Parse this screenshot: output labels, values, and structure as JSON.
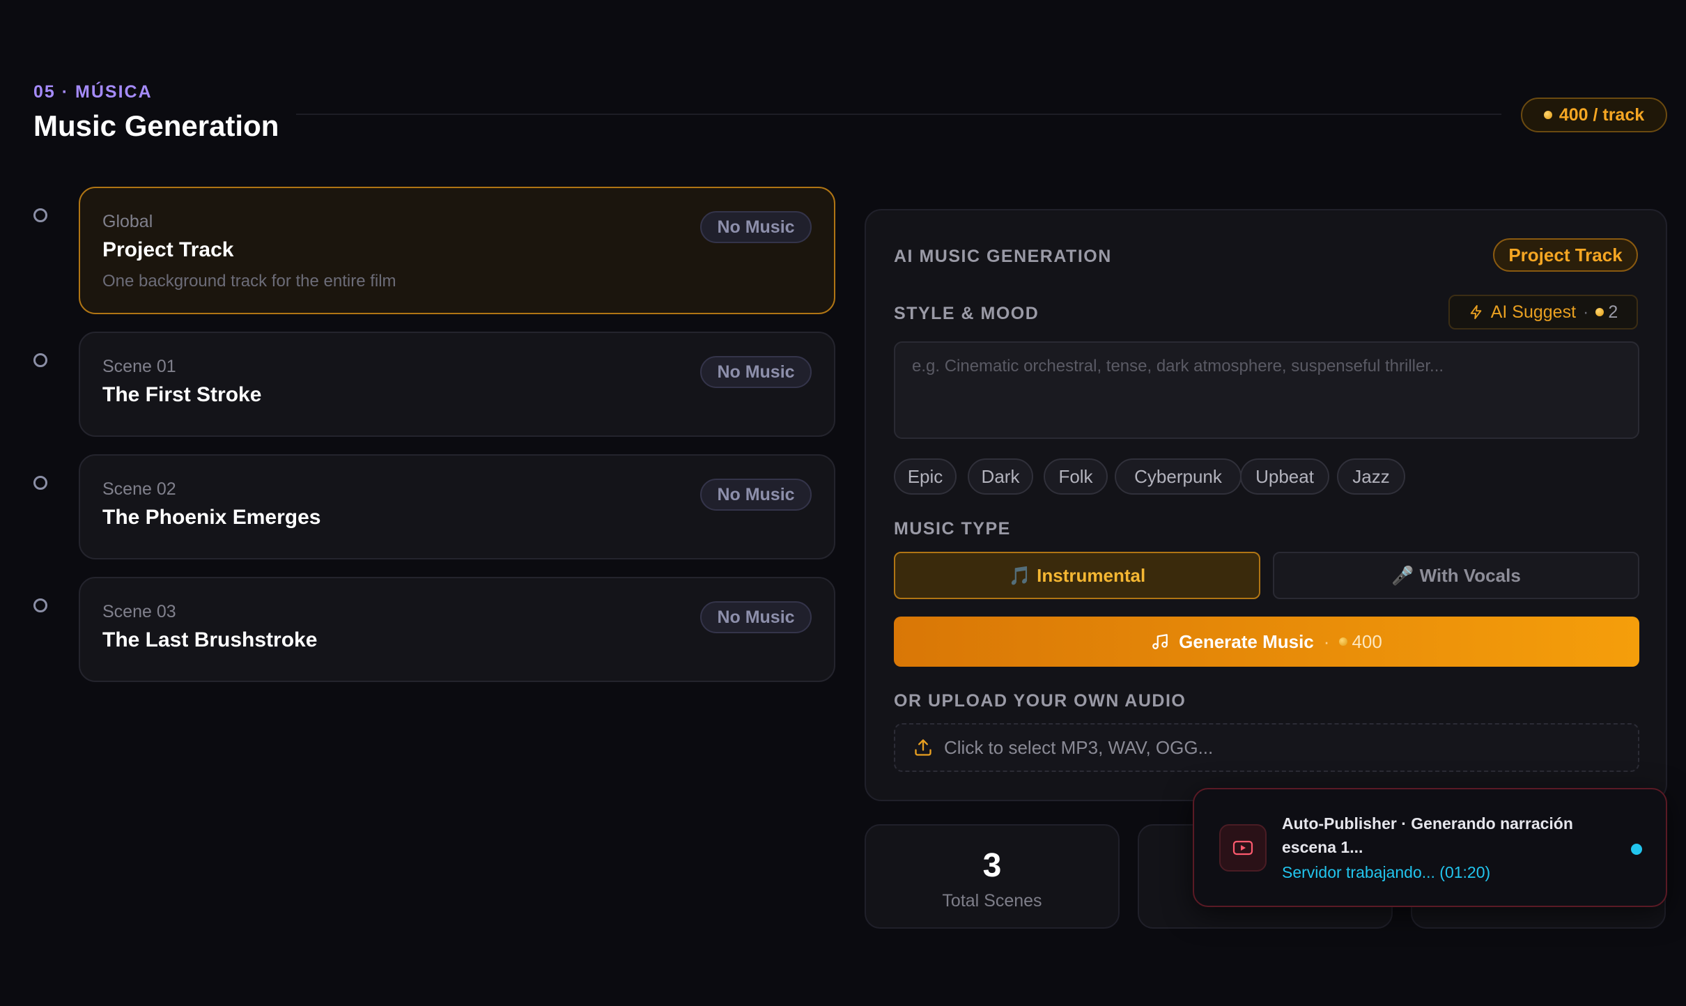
{
  "header": {
    "eyebrow": "05 · MÚSICA",
    "title": "Music Generation",
    "price_label": "400 / track"
  },
  "scenes": [
    {
      "kicker": "Global",
      "title": "Project Track",
      "description": "One background track for the entire film",
      "badge": "No Music",
      "active": true
    },
    {
      "kicker": "Scene 01",
      "title": "The First Stroke",
      "badge": "No Music",
      "active": false
    },
    {
      "kicker": "Scene 02",
      "title": "The Phoenix Emerges",
      "badge": "No Music",
      "active": false
    },
    {
      "kicker": "Scene 03",
      "title": "The Last Brushstroke",
      "badge": "No Music",
      "active": false
    }
  ],
  "panel": {
    "heading": "AI MUSIC GENERATION",
    "target_badge": "Project Track",
    "style_label": "STYLE & MOOD",
    "ai_suggest_label": "AI Suggest",
    "ai_suggest_cost": "2",
    "style_placeholder": "e.g. Cinematic orchestral, tense, dark atmosphere, suspenseful thriller...",
    "style_value": "",
    "chips": [
      "Epic",
      "Dark",
      "Folk",
      "Cyberpunk",
      "Upbeat",
      "Jazz"
    ],
    "music_type_label": "MUSIC TYPE",
    "music_types": [
      {
        "icon": "🎵",
        "label": "Instrumental",
        "selected": true
      },
      {
        "icon": "🎤",
        "label": "With Vocals",
        "selected": false
      }
    ],
    "generate_label": "Generate Music",
    "generate_cost": "400",
    "upload_label": "OR UPLOAD YOUR OWN AUDIO",
    "upload_hint": "Click to select MP3, WAV, OGG..."
  },
  "stats": [
    {
      "value": "3",
      "label": "Total Scenes"
    }
  ],
  "toast": {
    "title": "Auto-Publisher · Generando narración escena 1...",
    "status": "Servidor trabajando... (01:20)"
  },
  "colors": {
    "accent": "#f5a623",
    "eyebrow": "#a58bfa",
    "status": "#22c5ee",
    "background": "#0b0b10"
  }
}
